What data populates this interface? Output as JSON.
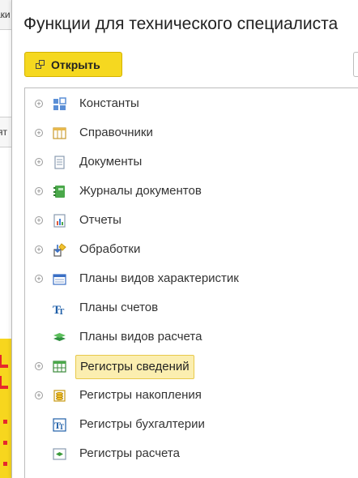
{
  "background": {
    "top_tab_text": "аки",
    "mid_tab_text": "ят"
  },
  "dialog": {
    "title": "Функции для технического специалиста",
    "open_button_label": "Открыть"
  },
  "tree": {
    "items": [
      {
        "label": "Константы",
        "icon": "constants-icon",
        "expandable": true
      },
      {
        "label": "Справочники",
        "icon": "catalogs-icon",
        "expandable": true
      },
      {
        "label": "Документы",
        "icon": "documents-icon",
        "expandable": true
      },
      {
        "label": "Журналы документов",
        "icon": "document-journals-icon",
        "expandable": true
      },
      {
        "label": "Отчеты",
        "icon": "reports-icon",
        "expandable": true
      },
      {
        "label": "Обработки",
        "icon": "data-processors-icon",
        "expandable": true
      },
      {
        "label": "Планы видов характеристик",
        "icon": "characteristic-types-icon",
        "expandable": true
      },
      {
        "label": "Планы счетов",
        "icon": "chart-of-accounts-icon",
        "expandable": false
      },
      {
        "label": "Планы видов расчета",
        "icon": "calculation-types-icon",
        "expandable": false
      },
      {
        "label": "Регистры сведений",
        "icon": "information-registers-icon",
        "expandable": true,
        "selected": true
      },
      {
        "label": "Регистры накопления",
        "icon": "accumulation-registers-icon",
        "expandable": true
      },
      {
        "label": "Регистры бухгалтерии",
        "icon": "accounting-registers-icon",
        "expandable": false
      },
      {
        "label": "Регистры расчета",
        "icon": "calculation-registers-icon",
        "expandable": false
      }
    ]
  },
  "colors": {
    "accent_yellow": "#f5d820",
    "selection_bg": "#fbeeb0",
    "selection_border": "#e8c94c"
  }
}
